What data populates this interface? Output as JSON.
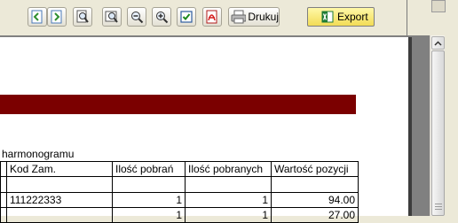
{
  "toolbar": {
    "icons": [
      "first-page-icon",
      "previous-page-icon",
      "zoom-page-icon",
      "zoom-fit-icon",
      "zoom-out-icon",
      "zoom-in-icon",
      "checkbox-icon",
      "pdf-icon",
      "printer-icon",
      "excel-icon"
    ],
    "print_label": "Drukuj",
    "export_label": "Export"
  },
  "report": {
    "subtitle": "harmonogramu",
    "columns": [
      "Kod Zam.",
      "Ilość pobrań",
      "Ilość pobranych",
      "Wartość pozycji"
    ],
    "rows": [
      [
        "111222333",
        "1",
        "1",
        "94.00"
      ],
      [
        "",
        "1",
        "1",
        "27.00"
      ]
    ]
  },
  "colors": {
    "header_bar": "#7b0000",
    "export_button": "#f5e05c"
  }
}
